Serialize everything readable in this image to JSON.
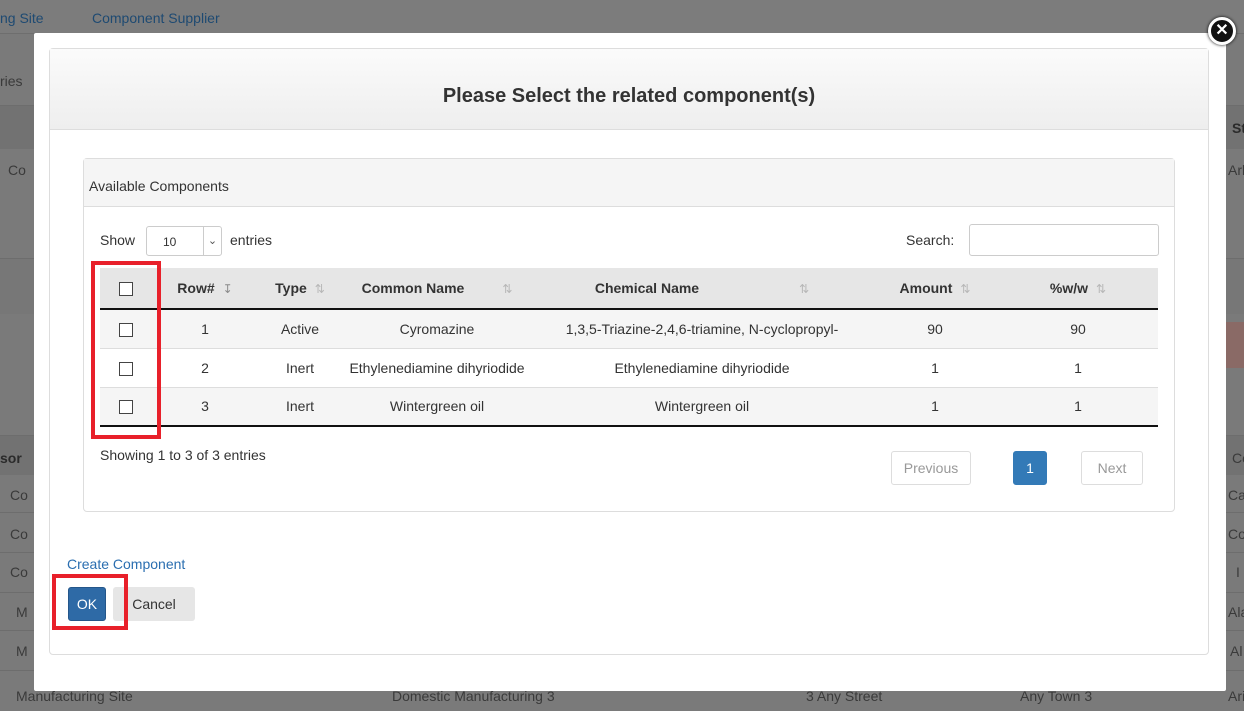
{
  "background": {
    "nav_items": [
      "ng Site",
      "Component Supplier"
    ],
    "fragments": {
      "left_ries": "ries",
      "left_co": "Co",
      "left_son": "sor",
      "left_co2": "Co",
      "left_co3": "Co",
      "left_co4": "Co",
      "left_m1": "M",
      "left_m2": "M",
      "bottom_text1": "Manufacturing Site",
      "bottom_text2": "Domestic Manufacturing 3",
      "bottom_text3": "3 Any Street",
      "bottom_text4": "Any Town 3",
      "right_st": "St",
      "right_ark": "Ark",
      "right_co": "Co",
      "right_cal": "Cal",
      "right_col": "Col",
      "right_i": "I",
      "right_ala": "Ala",
      "right_al": "Al",
      "right_ari": "Ari"
    }
  },
  "modal": {
    "title": "Please Select the related component(s)",
    "close_glyph": "✕",
    "panel_heading": "Available Components",
    "show_label": "Show",
    "entries_value": "10",
    "entries_label": "entries",
    "search_label": "Search:",
    "search_value": "",
    "columns": {
      "row": "Row#",
      "type": "Type",
      "common_name": "Common Name",
      "chemical_name": "Chemical Name",
      "amount": "Amount",
      "wpw": "%w/w"
    },
    "rows": [
      {
        "row": "1",
        "type": "Active",
        "common_name": "Cyromazine",
        "chemical_name": "1,3,5-Triazine-2,4,6-triamine, N-cyclopropyl-",
        "amount": "90",
        "wpw": "90"
      },
      {
        "row": "2",
        "type": "Inert",
        "common_name": "Ethylenediamine dihyriodide",
        "chemical_name": "Ethylenediamine dihyriodide",
        "amount": "1",
        "wpw": "1"
      },
      {
        "row": "3",
        "type": "Inert",
        "common_name": "Wintergreen oil",
        "chemical_name": "Wintergreen oil",
        "amount": "1",
        "wpw": "1"
      }
    ],
    "info": "Showing 1 to 3 of 3 entries",
    "pagination": {
      "previous": "Previous",
      "page": "1",
      "next": "Next"
    },
    "create_link": "Create Component",
    "ok_label": "OK",
    "cancel_label": "Cancel"
  },
  "colors": {
    "primary": "#337ab7",
    "highlight": "#e8202a",
    "link": "#2a6eb0"
  }
}
